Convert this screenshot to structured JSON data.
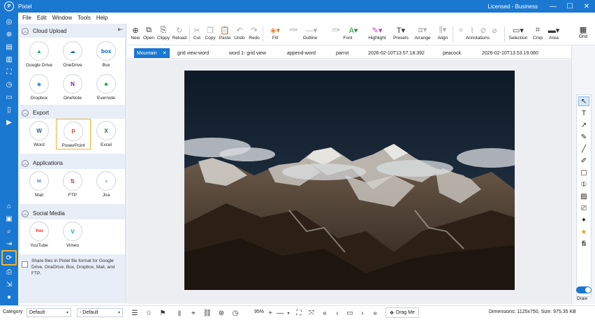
{
  "titlebar": {
    "title": "Pixtel",
    "license": "Licensed - Business",
    "minimize": "—",
    "maximize": "☐",
    "close": "✕"
  },
  "menu": [
    "File",
    "Edit",
    "Window",
    "Tools",
    "Help"
  ],
  "sidepanel": {
    "cloud_upload": {
      "title": "Cloud Upload",
      "items": [
        "Google Drive",
        "OneDrive",
        "Box",
        "Dropbox",
        "OneNote",
        "Evernote"
      ]
    },
    "export": {
      "title": "Export",
      "items": [
        "Word",
        "PowerPoint",
        "Excel"
      ]
    },
    "applications": {
      "title": "Applications",
      "items": [
        "Mail",
        "FTP",
        "Jira"
      ]
    },
    "social_media": {
      "title": "Social Media",
      "items": [
        "YouTube",
        "Vimeo"
      ]
    },
    "share_text": "Share files in Pixtel file format for Google Drive, OneDrive, Box, Dropbox, Mail, and FTP."
  },
  "toolbar": {
    "new": "New",
    "open": "Open",
    "clippy": "Clippy",
    "reload": "Reload",
    "cut": "Cut",
    "copy": "Copy",
    "paste": "Paste",
    "undo": "Undo",
    "redo": "Redo",
    "fill": "Fill",
    "outline": "Outline",
    "outline_width": "6",
    "font": "Font",
    "font_size": "20",
    "highlight": "Highlight",
    "presets": "Presets",
    "arrange": "Arrange",
    "align": "Align",
    "annotations": "Annotations",
    "selection": "Selection",
    "crop": "Crop",
    "area": "Area",
    "grid": "Grid"
  },
  "tabs": [
    "Mountain",
    "grid view-word",
    "word 1- grid view",
    "append-word",
    "parrot",
    "2026-02-10T13.57.18.392",
    "peacock",
    "2026-02-10T13.53.19.060"
  ],
  "statusbar": {
    "category_label": "Category",
    "category_value": "Default",
    "second_value": "- Default",
    "zoom": "95%",
    "drag_me": "Drag Me",
    "dimensions": "Dimensions: 1125x750, Size: 975.35 KB"
  },
  "right": {
    "draw": "Draw"
  },
  "colors": {
    "accent": "#1a78d1",
    "highlight_border": "#f0b429"
  }
}
